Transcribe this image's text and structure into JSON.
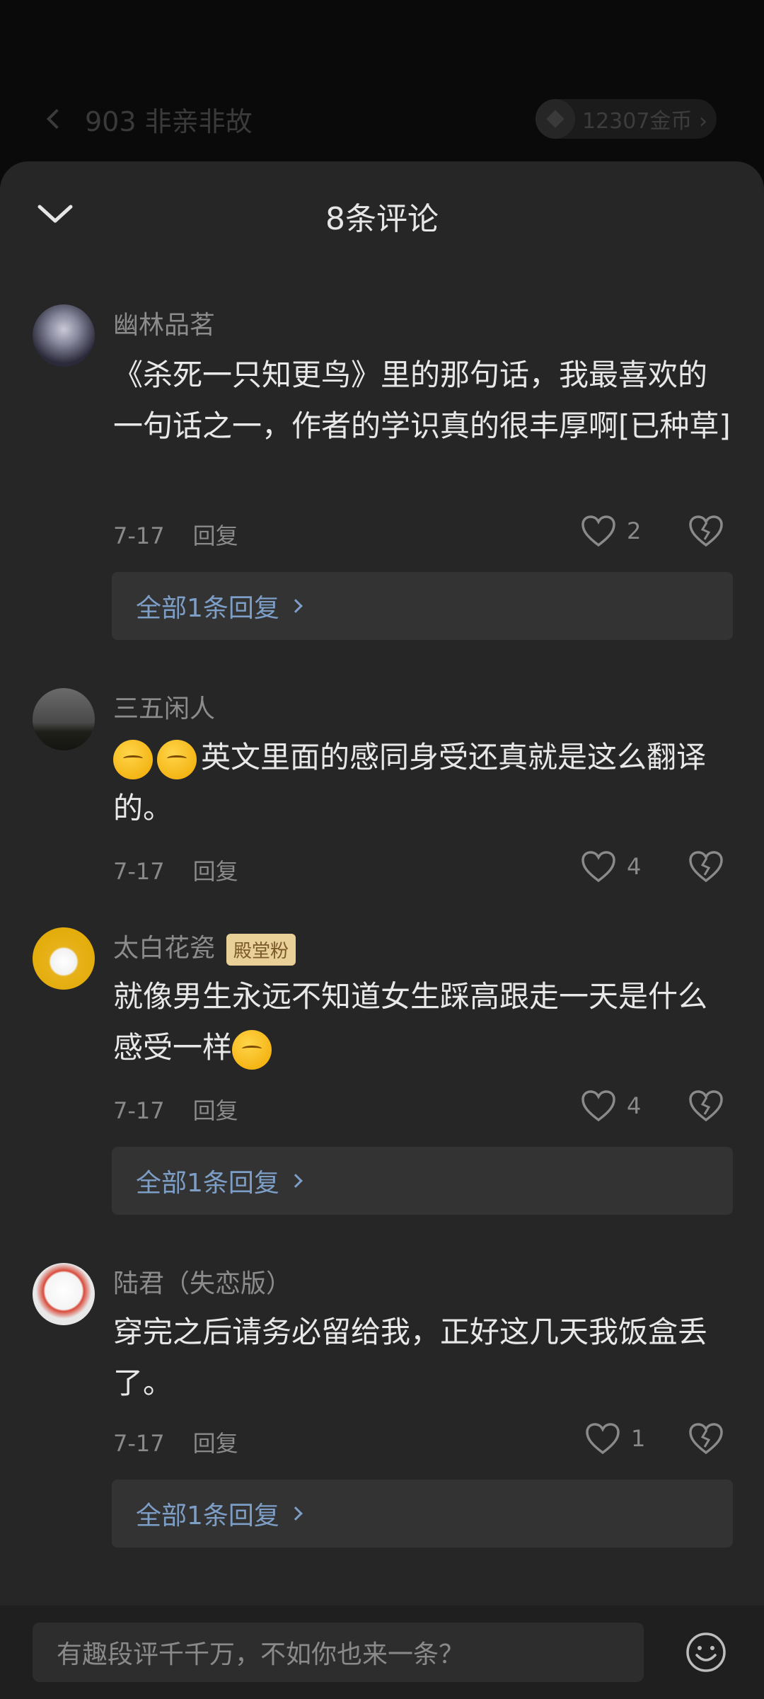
{
  "background_header": {
    "back_title": "903 非亲非故",
    "coins": "12307金币 ›"
  },
  "sheet": {
    "title": "8条评论"
  },
  "comments": [
    {
      "username": "幽林品茗",
      "badge": "",
      "text": "《杀死一只知更鸟》里的那句话，我最喜欢的一句话之一，作者的学识真的很丰厚啊[已种草]",
      "date": "7-17",
      "reply_label": "回复",
      "likes": "2",
      "replies_label": "全部1条回复"
    },
    {
      "username": "三五闲人",
      "badge": "",
      "text": "英文里面的感同身受还真就是这么翻译的。",
      "date": "7-17",
      "reply_label": "回复",
      "likes": "4",
      "replies_label": ""
    },
    {
      "username": "太白花瓷",
      "badge": "殿堂粉",
      "text": "就像男生永远不知道女生踩高跟走一天是什么感受一样",
      "date": "7-17",
      "reply_label": "回复",
      "likes": "4",
      "replies_label": "全部1条回复"
    },
    {
      "username": "陆君（失恋版）",
      "badge": "",
      "text": "穿完之后请务必留给我，正好这几天我饭盒丢了。",
      "date": "7-17",
      "reply_label": "回复",
      "likes": "1",
      "replies_label": "全部1条回复"
    }
  ],
  "input": {
    "placeholder": "有趣段评千千万，不如你也来一条？"
  },
  "colors": {
    "sheet_bg": "#262626",
    "reply_link": "#7d9ec6",
    "badge_bg": "#e9cf98"
  }
}
